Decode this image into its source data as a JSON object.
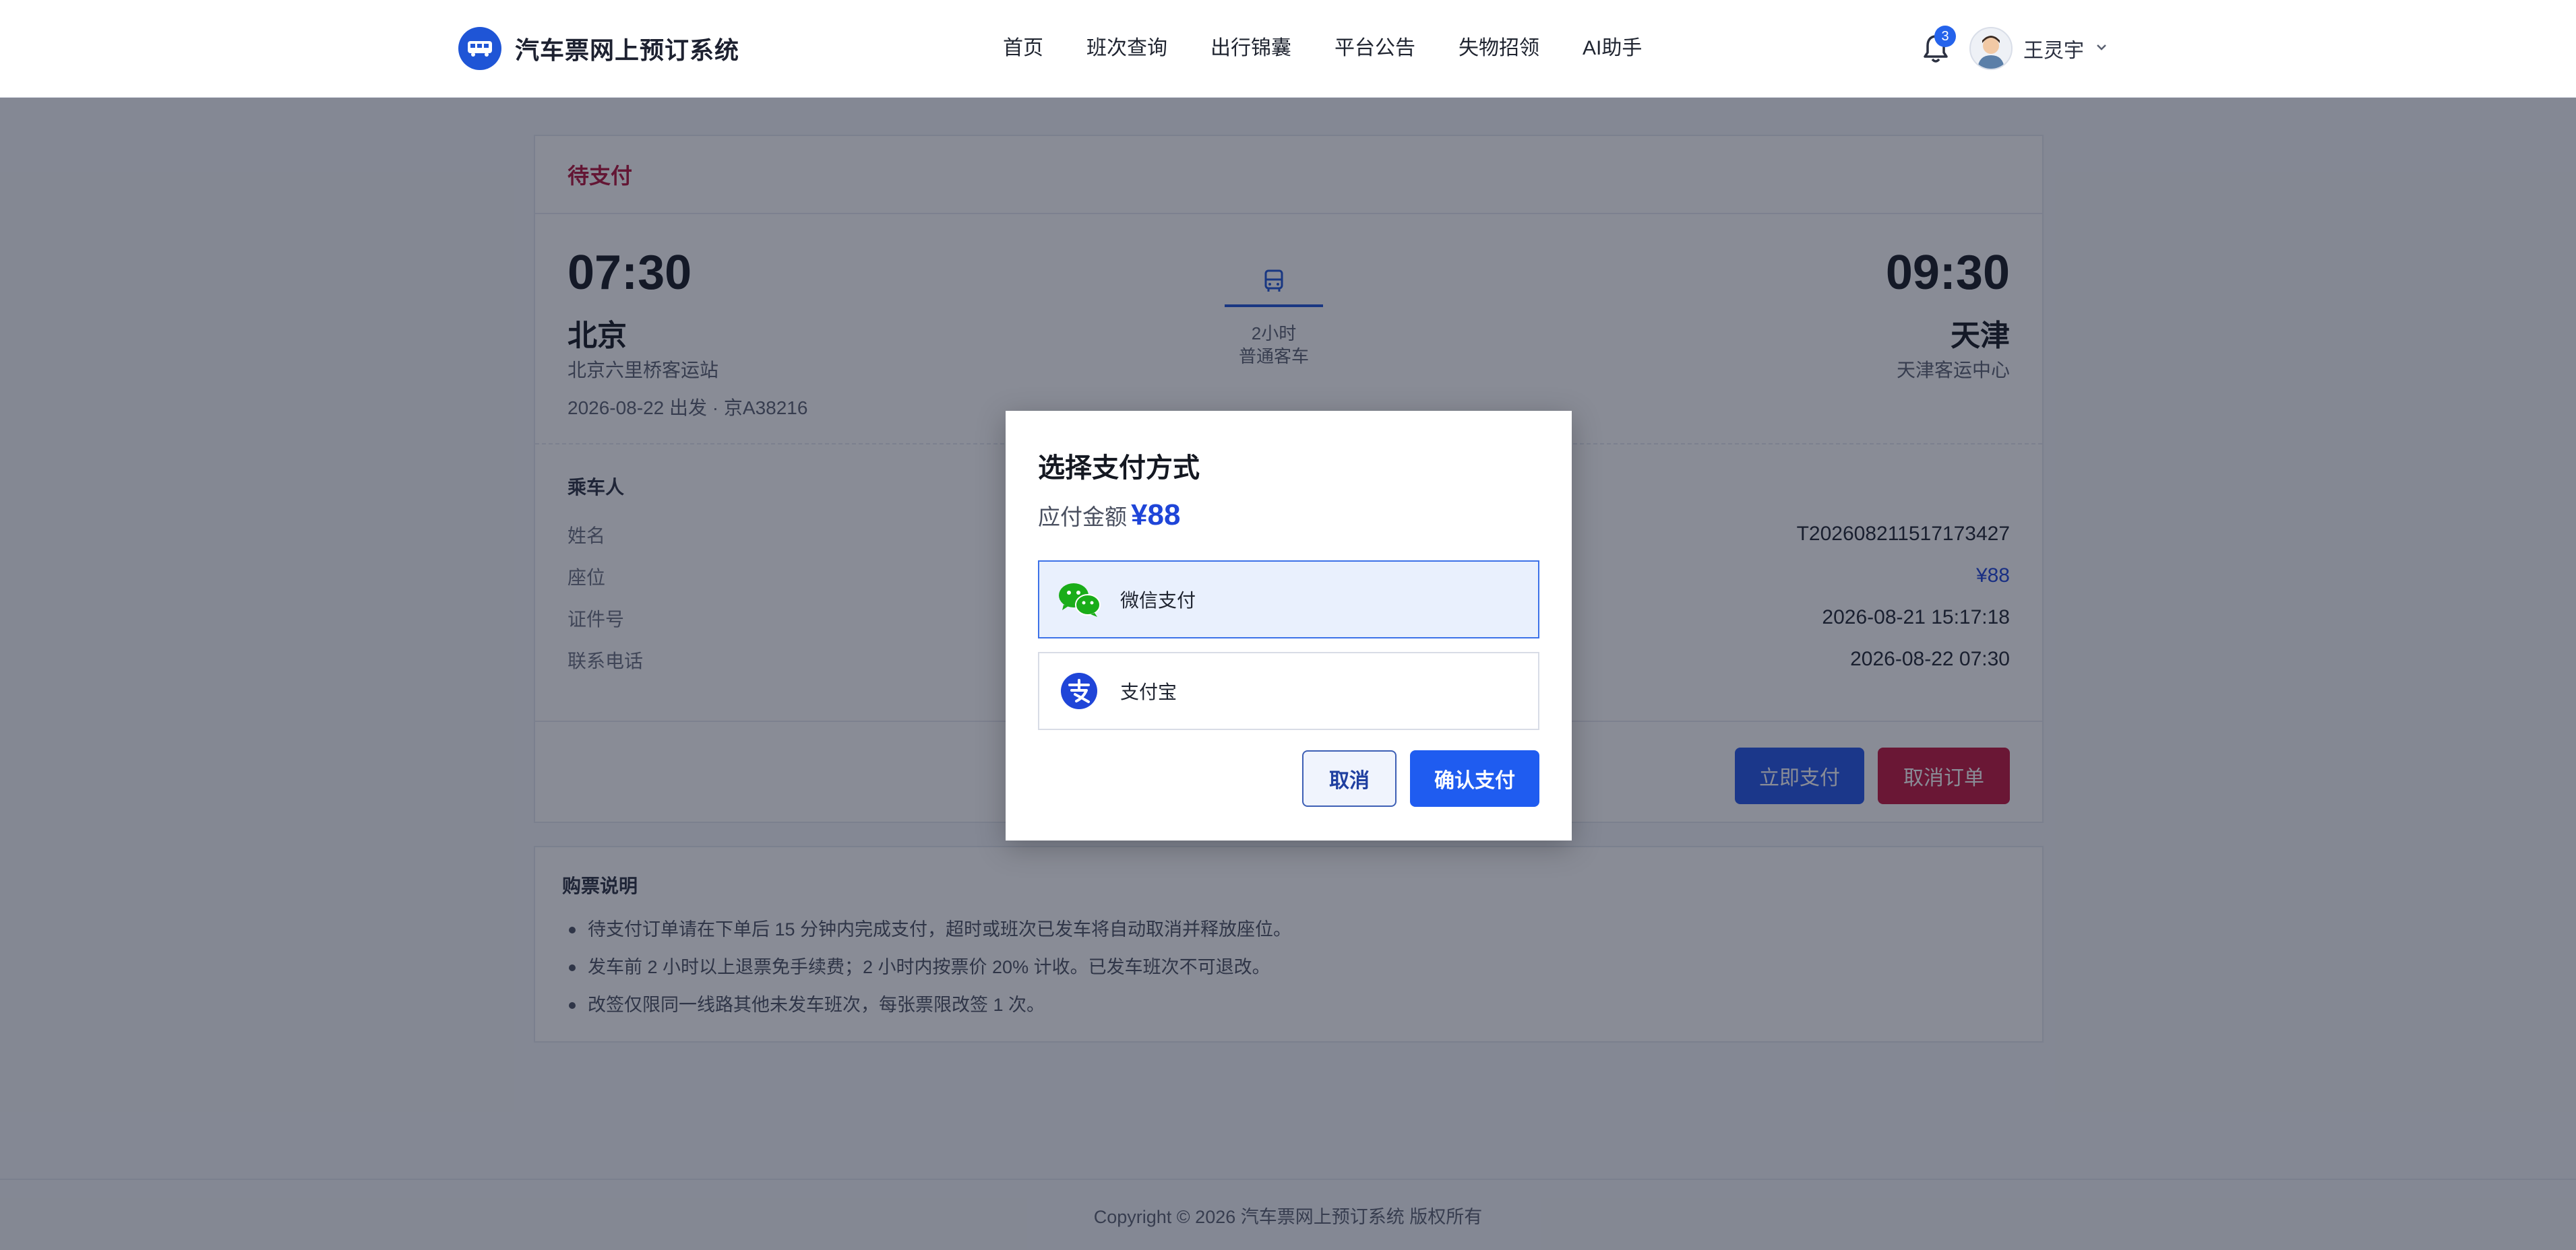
{
  "header": {
    "title": "汽车票网上预订系统",
    "logo_icon": "bus-icon",
    "nav": [
      "首页",
      "班次查询",
      "出行锦囊",
      "平台公告",
      "失物招领",
      "AI助手"
    ],
    "notification_count": "3",
    "user_name": "王灵宇"
  },
  "order": {
    "status": "待支付",
    "depart_time": "07:30",
    "depart_city": "北京",
    "depart_station": "北京六里桥客运站",
    "trip_meta": "2026-08-22 出发 · 京A38216",
    "duration": "2小时",
    "bus_type": "普通客车",
    "arrive_time": "09:30",
    "arrive_city": "天津",
    "arrive_station": "天津客运中心",
    "passenger_title": "乘车人",
    "labels": [
      "姓名",
      "座位",
      "证件号",
      "联系电话"
    ],
    "values": [
      "T202608211517173427",
      "¥88",
      "2026-08-21 15:17:18",
      "2026-08-22 07:30"
    ],
    "pay_button": "立即支付",
    "cancel_button": "取消订单"
  },
  "notes": {
    "title": "购票说明",
    "items": [
      "待支付订单请在下单后 15 分钟内完成支付，超时或班次已发车将自动取消并释放座位。",
      "发车前 2 小时以上退票免手续费；2 小时内按票价 20% 计收。已发车班次不可退改。",
      "改签仅限同一线路其他未发车班次，每张票限改签 1 次。"
    ]
  },
  "footer": {
    "copyright": "Copyright © 2026 汽车票网上预订系统 版权所有"
  },
  "modal": {
    "title": "选择支付方式",
    "amount_label": "应付金额",
    "amount": "¥88",
    "options": [
      {
        "label": "微信支付",
        "icon": "wechat-pay-icon",
        "selected": true,
        "color": "#1aad19"
      },
      {
        "label": "支付宝",
        "icon": "alipay-icon",
        "selected": false,
        "color": "#1f45d8"
      }
    ],
    "cancel": "取消",
    "confirm": "确认支付"
  },
  "colors": {
    "primary": "#1f5cf0",
    "danger": "#c0143c",
    "overlay": "rgba(20,26,45,0.50)"
  }
}
